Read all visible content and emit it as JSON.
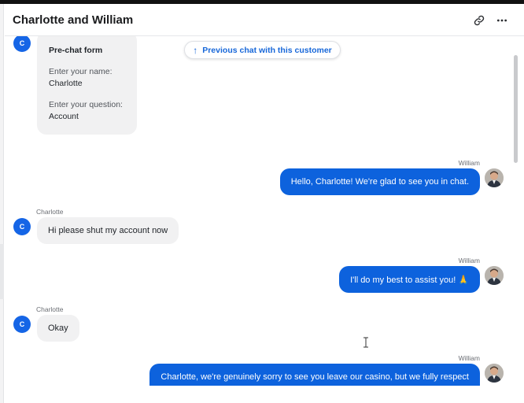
{
  "header": {
    "title": "Charlotte and William",
    "link_icon": "link-icon",
    "more_icon": "more-horizontal-icon"
  },
  "prev_chat": {
    "arrow": "↑",
    "label": "Previous chat with this customer"
  },
  "prechat": {
    "avatar": "C",
    "title": "Pre-chat form",
    "name_label": "Enter your name:",
    "name_value": "Charlotte",
    "question_label": "Enter your question:",
    "question_value": "Account"
  },
  "messages": [
    {
      "sender": "William",
      "text": "Hello, Charlotte! We're glad to see you in chat.",
      "direction": "outgoing"
    },
    {
      "sender": "Charlotte",
      "avatar": "C",
      "text": "Hi please shut my account now",
      "direction": "incoming"
    },
    {
      "sender": "William",
      "text": "I'll do my best to assist you! 🙏",
      "direction": "outgoing"
    },
    {
      "sender": "Charlotte",
      "avatar": "C",
      "text": "Okay",
      "direction": "incoming"
    },
    {
      "sender": "William",
      "text": "Charlotte, we're genuinely sorry to see you leave our casino, but we fully respect",
      "direction": "outgoing"
    }
  ],
  "colors": {
    "accent": "#0d62dd",
    "customer_avatar": "#1565e6",
    "incoming_bubble": "#f1f1f2"
  }
}
